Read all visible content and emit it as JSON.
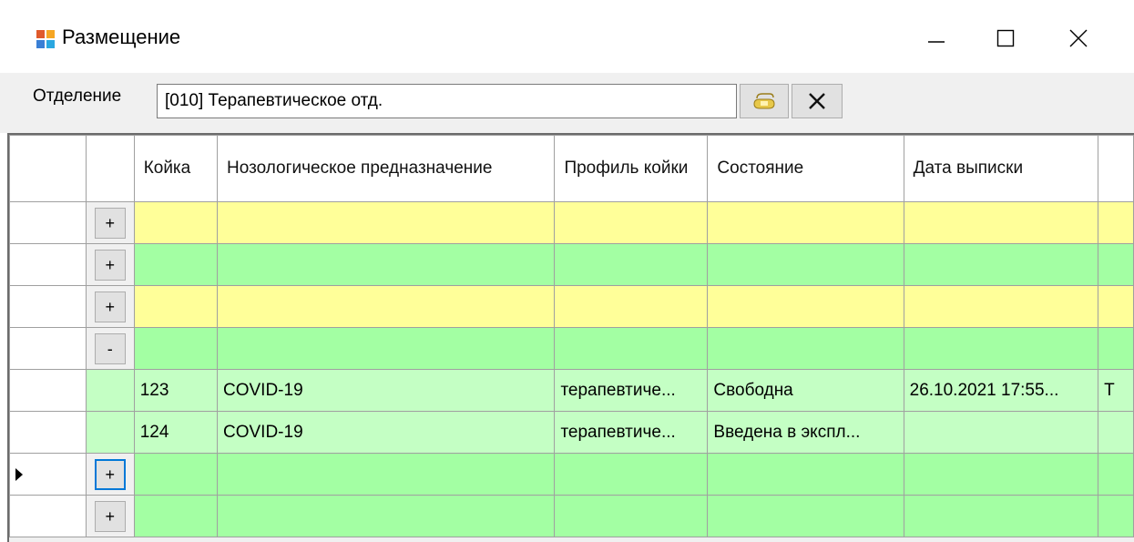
{
  "window": {
    "title": "Размещение",
    "icons": [
      "app-icon",
      "minimize-icon",
      "maximize-icon",
      "close-icon"
    ]
  },
  "toolbar": {
    "department_label": "Отделение",
    "department_value": "[010] Терапевтическое отд.",
    "icons": [
      "select-icon",
      "clear-icon"
    ]
  },
  "grid": {
    "columns": [
      "",
      "",
      "Койка",
      "Нозологическое предназначение",
      "Профиль койки",
      "Состояние",
      "Дата выписки"
    ],
    "rows": [
      {
        "type": "group",
        "color": "yellow",
        "toggle": "+"
      },
      {
        "type": "group",
        "color": "green",
        "toggle": "+"
      },
      {
        "type": "group",
        "color": "yellow",
        "toggle": "+"
      },
      {
        "type": "group",
        "color": "green",
        "toggle": "-"
      },
      {
        "type": "child",
        "cells": [
          "123",
          "COVID-19",
          "терапевтиче...",
          "Свободна",
          "26.10.2021 17:55...",
          "Т"
        ]
      },
      {
        "type": "child",
        "cells": [
          "124",
          "COVID-19",
          "терапевтиче...",
          "Введена в экспл...",
          "",
          ""
        ]
      },
      {
        "type": "group",
        "color": "green",
        "toggle": "+",
        "current": true
      },
      {
        "type": "group",
        "color": "green",
        "toggle": "+"
      }
    ]
  },
  "colors": {
    "yellow_row": "#ffff99",
    "green_row": "#a3ffa3",
    "child_row": "#c4ffc4",
    "focus": "#0078d7"
  }
}
